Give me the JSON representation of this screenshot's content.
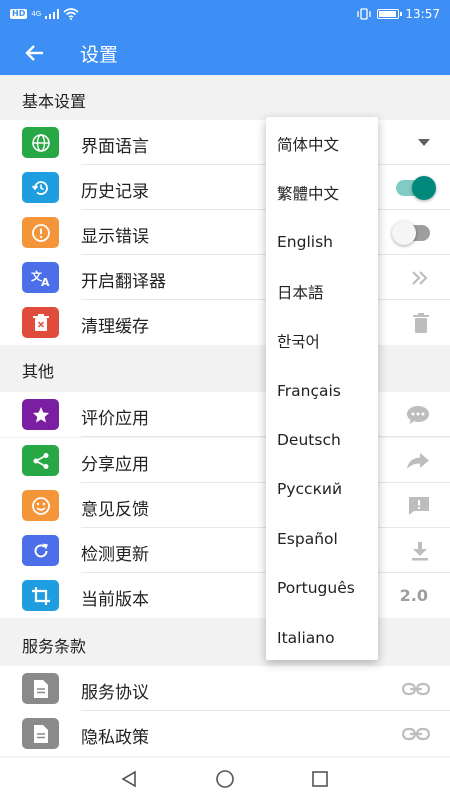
{
  "status_bar": {
    "network": "HD",
    "signal": "4G",
    "time": "13:57",
    "battery_level": 0.9
  },
  "app_bar": {
    "title": "设置",
    "back_icon": "arrow-left-icon"
  },
  "sections": {
    "basic": "基本设置",
    "other": "其他",
    "terms": "服务条款"
  },
  "rows": {
    "language": {
      "label": "界面语言",
      "icon": "globe-icon",
      "color": "#28a745"
    },
    "history": {
      "label": "历史记录",
      "icon": "history-icon",
      "color": "#1e9ee0",
      "toggle": true
    },
    "errors": {
      "label": "显示错误",
      "icon": "alert-icon",
      "color": "#f5953a",
      "toggle": false
    },
    "translator": {
      "label": "开启翻译器",
      "icon": "translate-icon",
      "color": "#4c6ee8"
    },
    "cache": {
      "label": "清理缓存",
      "icon": "trash-icon",
      "color": "#e04c3c"
    },
    "rate": {
      "label": "评价应用",
      "icon": "star-icon",
      "color": "#7b1fa2"
    },
    "share": {
      "label": "分享应用",
      "icon": "share-icon",
      "color": "#28a745"
    },
    "feedback": {
      "label": "意见反馈",
      "icon": "smile-icon",
      "color": "#f5953a"
    },
    "update": {
      "label": "检测更新",
      "icon": "refresh-icon",
      "color": "#4c6ee8"
    },
    "version": {
      "label": "当前版本",
      "icon": "crop-icon",
      "color": "#1e9ee0",
      "value": "2.0"
    },
    "service": {
      "label": "服务协议",
      "icon": "document-icon",
      "color": "#8a8a8a"
    },
    "privacy": {
      "label": "隐私政策",
      "icon": "document-icon",
      "color": "#8a8a8a"
    }
  },
  "language_dropdown": {
    "options": [
      "简体中文",
      "繁體中文",
      "English",
      "日本語",
      "한국어",
      "Français",
      "Deutsch",
      "Русский",
      "Español",
      "Português",
      "Italiano"
    ]
  },
  "colors": {
    "primary": "#3d8ff5",
    "toggle_on": "#00897b"
  }
}
